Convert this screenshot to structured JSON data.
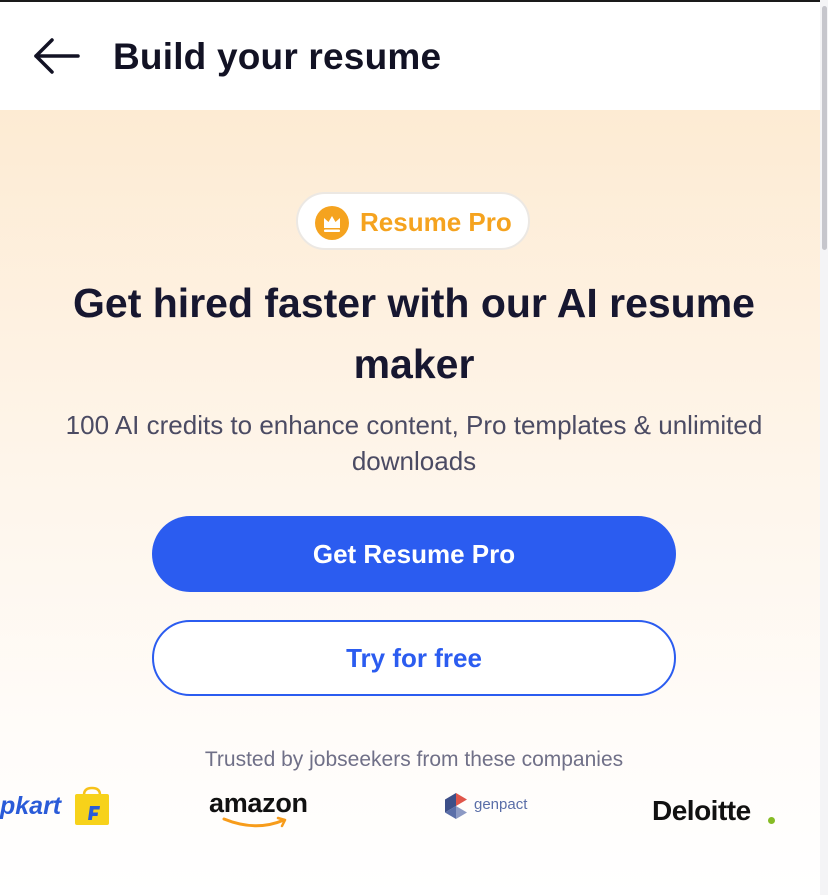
{
  "header": {
    "back_icon": "arrow-left-icon",
    "title": "Build your resume"
  },
  "hero": {
    "badge": {
      "icon": "crown-icon",
      "label": "Resume Pro",
      "color": "#f5a31f"
    },
    "headline": "Get hired faster with our AI resume maker",
    "subtext": "100 AI credits to enhance content, Pro templates & unlimited downloads",
    "primary_button": "Get Resume Pro",
    "secondary_button": "Try for free",
    "accent_color": "#2b5cf0"
  },
  "trusted": {
    "text": "Trusted by jobseekers from these companies",
    "logos": {
      "flipkart": "pkart",
      "amazon": "amazon",
      "genpact": "genpact",
      "deloitte": "Deloitte"
    }
  }
}
